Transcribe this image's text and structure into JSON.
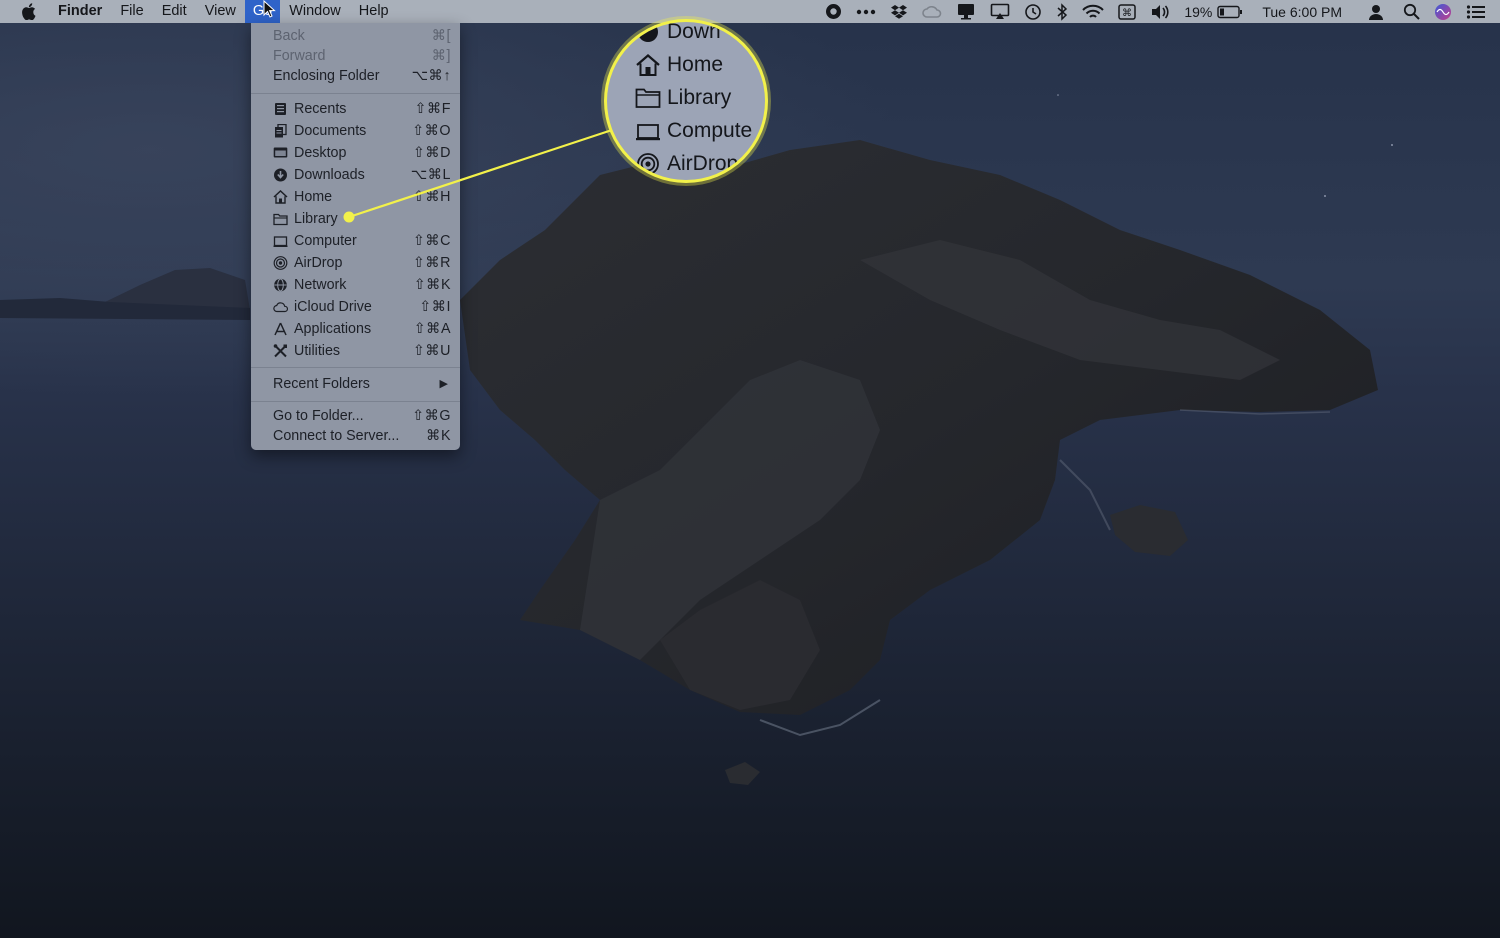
{
  "menubar": {
    "app_name": "Finder",
    "menus": [
      "File",
      "Edit",
      "View",
      "Go",
      "Window",
      "Help"
    ],
    "battery_percent": "19%",
    "clock": "Tue 6:00 PM",
    "status_icons": [
      "record-icon",
      "ellipsis-icon",
      "dropbox-icon",
      "creative-cloud-icon",
      "display-icon",
      "airplay-icon",
      "time-machine-icon",
      "bluetooth-icon",
      "wifi-icon",
      "keyboard-icon",
      "volume-icon",
      "battery-icon",
      "user-icon",
      "spotlight-icon",
      "siri-icon",
      "notification-center-icon"
    ]
  },
  "go_menu": {
    "items": [
      {
        "label": "Back",
        "shortcut": "⌘[",
        "disabled": true
      },
      {
        "label": "Forward",
        "shortcut": "⌘]",
        "disabled": true
      },
      {
        "label": "Enclosing Folder",
        "shortcut": "⌥⌘↑",
        "disabled": false
      },
      {
        "label": "Recents",
        "shortcut": "⇧⌘F",
        "icon": "recents-icon"
      },
      {
        "label": "Documents",
        "shortcut": "⇧⌘O",
        "icon": "documents-icon"
      },
      {
        "label": "Desktop",
        "shortcut": "⇧⌘D",
        "icon": "desktop-icon"
      },
      {
        "label": "Downloads",
        "shortcut": "⌥⌘L",
        "icon": "downloads-icon"
      },
      {
        "label": "Home",
        "shortcut": "⇧⌘H",
        "icon": "home-icon"
      },
      {
        "label": "Library",
        "shortcut": "",
        "icon": "folder-icon"
      },
      {
        "label": "Computer",
        "shortcut": "⇧⌘C",
        "icon": "computer-icon"
      },
      {
        "label": "AirDrop",
        "shortcut": "⇧⌘R",
        "icon": "airdrop-icon"
      },
      {
        "label": "Network",
        "shortcut": "⇧⌘K",
        "icon": "network-icon"
      },
      {
        "label": "iCloud Drive",
        "shortcut": "⇧⌘I",
        "icon": "icloud-icon"
      },
      {
        "label": "Applications",
        "shortcut": "⇧⌘A",
        "icon": "applications-icon"
      },
      {
        "label": "Utilities",
        "shortcut": "⇧⌘U",
        "icon": "utilities-icon"
      },
      {
        "label": "Recent Folders",
        "shortcut": "",
        "submenu": true
      },
      {
        "label": "Go to Folder...",
        "shortcut": "⇧⌘G"
      },
      {
        "label": "Connect to Server...",
        "shortcut": "⌘K"
      }
    ]
  },
  "callout": {
    "highlight_color": "#f2f14a",
    "items": [
      "Down",
      "Home",
      "Library",
      "Compute",
      "AirDrop"
    ]
  },
  "colors": {
    "menubar_bg": "#a9b0ba",
    "menu_bg": "#8f96a4",
    "active_menu": "#2f63c9",
    "wallpaper_sea": "#1a2233"
  }
}
